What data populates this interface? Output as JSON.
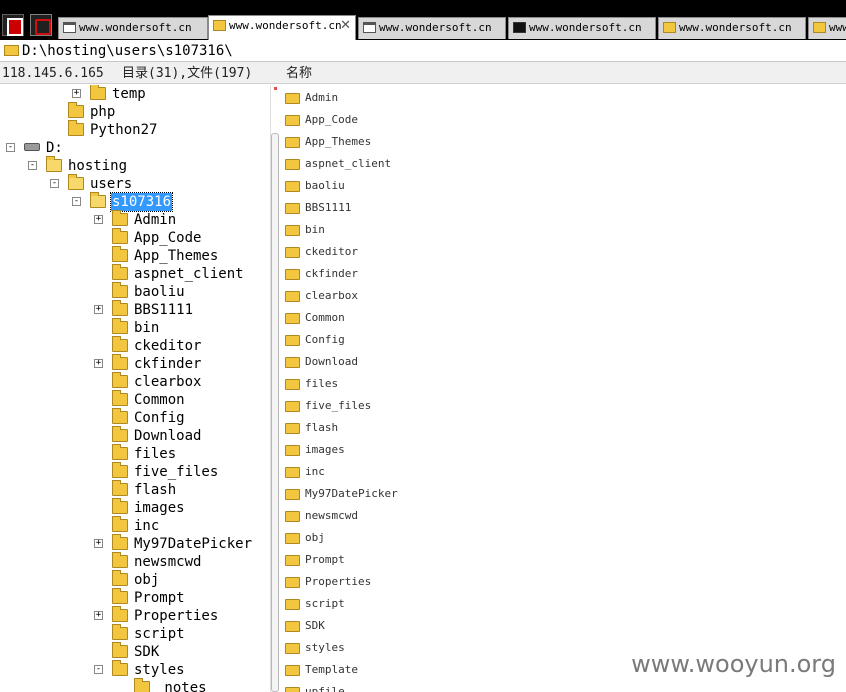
{
  "tabs": [
    {
      "title": "www.wondersoft.cn",
      "icon": "page",
      "active": false,
      "closable": false
    },
    {
      "title": "www.wondersoft.cn",
      "icon": "folder",
      "active": true,
      "closable": true
    },
    {
      "title": "www.wondersoft.cn",
      "icon": "page",
      "active": false,
      "closable": false
    },
    {
      "title": "www.wondersoft.cn",
      "icon": "cmd",
      "active": false,
      "closable": false
    },
    {
      "title": "www.wondersoft.cn",
      "icon": "folder",
      "active": false,
      "closable": false
    },
    {
      "title": "www",
      "icon": "folder",
      "active": false,
      "closable": false
    }
  ],
  "tab_close_glyph": "✕",
  "address": {
    "path": "D:\\hosting\\users\\s107316\\"
  },
  "status": {
    "ip": "118.145.6.165",
    "counts": "目录(31),文件(197)",
    "column_name": "名称"
  },
  "tree": [
    {
      "label": "temp",
      "depth": 3,
      "expander": "+",
      "icon": "folder"
    },
    {
      "label": "php",
      "depth": 2,
      "expander": "",
      "icon": "folder"
    },
    {
      "label": "Python27",
      "depth": 2,
      "expander": "",
      "icon": "folder"
    },
    {
      "label": "D:",
      "depth": 0,
      "expander": "-",
      "icon": "drive"
    },
    {
      "label": "hosting",
      "depth": 1,
      "expander": "-",
      "icon": "folder-open"
    },
    {
      "label": "users",
      "depth": 2,
      "expander": "-",
      "icon": "folder-open"
    },
    {
      "label": "s107316",
      "depth": 3,
      "expander": "-",
      "icon": "folder-open",
      "selected": true
    },
    {
      "label": "Admin",
      "depth": 4,
      "expander": "+",
      "icon": "folder"
    },
    {
      "label": "App_Code",
      "depth": 4,
      "expander": "",
      "icon": "folder"
    },
    {
      "label": "App_Themes",
      "depth": 4,
      "expander": "",
      "icon": "folder"
    },
    {
      "label": "aspnet_client",
      "depth": 4,
      "expander": "",
      "icon": "folder"
    },
    {
      "label": "baoliu",
      "depth": 4,
      "expander": "",
      "icon": "folder"
    },
    {
      "label": "BBS1111",
      "depth": 4,
      "expander": "+",
      "icon": "folder"
    },
    {
      "label": "bin",
      "depth": 4,
      "expander": "",
      "icon": "folder"
    },
    {
      "label": "ckeditor",
      "depth": 4,
      "expander": "",
      "icon": "folder"
    },
    {
      "label": "ckfinder",
      "depth": 4,
      "expander": "+",
      "icon": "folder"
    },
    {
      "label": "clearbox",
      "depth": 4,
      "expander": "",
      "icon": "folder"
    },
    {
      "label": "Common",
      "depth": 4,
      "expander": "",
      "icon": "folder"
    },
    {
      "label": "Config",
      "depth": 4,
      "expander": "",
      "icon": "folder"
    },
    {
      "label": "Download",
      "depth": 4,
      "expander": "",
      "icon": "folder"
    },
    {
      "label": "files",
      "depth": 4,
      "expander": "",
      "icon": "folder"
    },
    {
      "label": "five_files",
      "depth": 4,
      "expander": "",
      "icon": "folder"
    },
    {
      "label": "flash",
      "depth": 4,
      "expander": "",
      "icon": "folder"
    },
    {
      "label": "images",
      "depth": 4,
      "expander": "",
      "icon": "folder"
    },
    {
      "label": "inc",
      "depth": 4,
      "expander": "",
      "icon": "folder"
    },
    {
      "label": "My97DatePicker",
      "depth": 4,
      "expander": "+",
      "icon": "folder"
    },
    {
      "label": "newsmcwd",
      "depth": 4,
      "expander": "",
      "icon": "folder"
    },
    {
      "label": "obj",
      "depth": 4,
      "expander": "",
      "icon": "folder"
    },
    {
      "label": "Prompt",
      "depth": 4,
      "expander": "",
      "icon": "folder"
    },
    {
      "label": "Properties",
      "depth": 4,
      "expander": "+",
      "icon": "folder"
    },
    {
      "label": "script",
      "depth": 4,
      "expander": "",
      "icon": "folder"
    },
    {
      "label": "SDK",
      "depth": 4,
      "expander": "",
      "icon": "folder"
    },
    {
      "label": "styles",
      "depth": 4,
      "expander": "-",
      "icon": "folder"
    },
    {
      "label": "_notes",
      "depth": 5,
      "expander": "",
      "icon": "folder"
    }
  ],
  "files": [
    "Admin",
    "App_Code",
    "App_Themes",
    "aspnet_client",
    "baoliu",
    "BBS1111",
    "bin",
    "ckeditor",
    "ckfinder",
    "clearbox",
    "Common",
    "Config",
    "Download",
    "files",
    "five_files",
    "flash",
    "images",
    "inc",
    "My97DatePicker",
    "newsmcwd",
    "obj",
    "Prompt",
    "Properties",
    "script",
    "SDK",
    "styles",
    "Template",
    "upfile"
  ],
  "watermark": "www.wooyun.org",
  "colors": {
    "selection": "#3399ff",
    "folder": "#f3c640",
    "tabbar": "#000000"
  }
}
